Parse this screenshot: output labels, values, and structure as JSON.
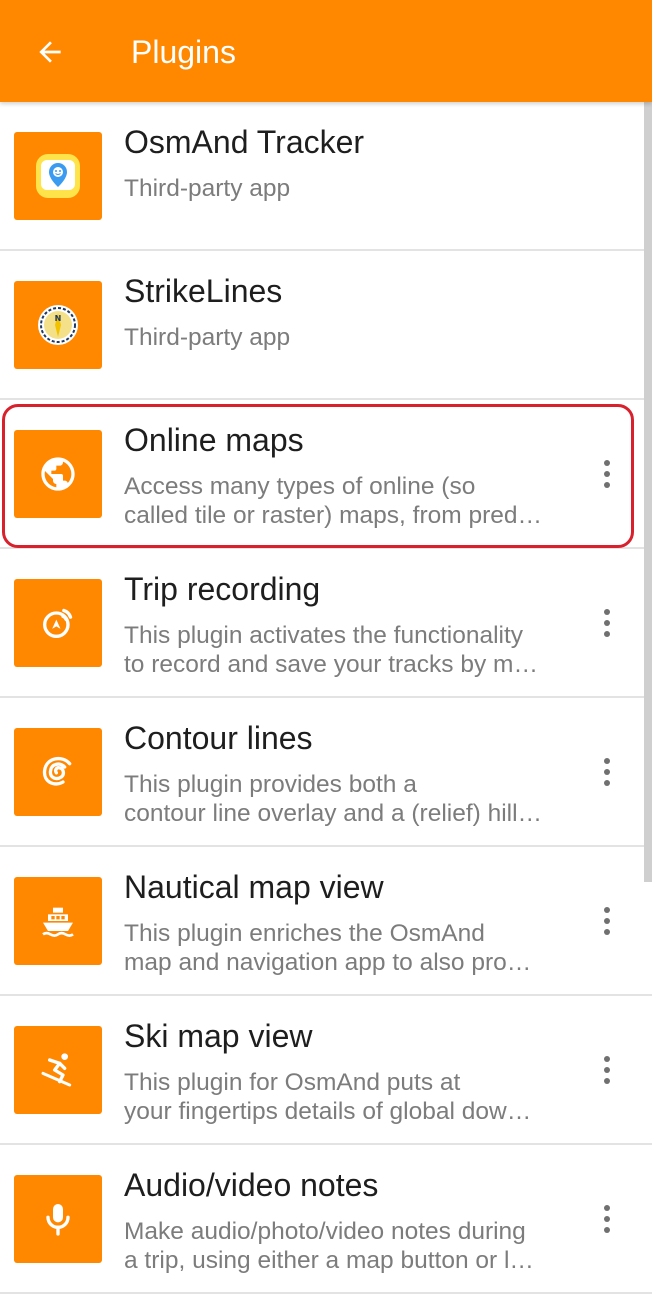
{
  "header": {
    "title": "Plugins",
    "back_icon": "arrow-back-icon",
    "background_color": "#ff8800"
  },
  "plugins": [
    {
      "title": "OsmAnd Tracker",
      "line1": "Third-party app",
      "line2": "",
      "icon": "tracker-app-icon",
      "has_menu": false
    },
    {
      "title": "StrikeLines",
      "line1": "Third-party app",
      "line2": "",
      "icon": "strikelines-app-icon",
      "has_menu": false
    },
    {
      "title": "Online maps",
      "line1": "Access many types of online (so",
      "line2": "called tile or raster) maps, from pred…",
      "icon": "globe-icon",
      "has_menu": true,
      "highlighted": true
    },
    {
      "title": "Trip recording",
      "line1": "This plugin activates the functionality",
      "line2": "to record and save your tracks by m…",
      "icon": "trip-recording-icon",
      "has_menu": true
    },
    {
      "title": "Contour lines",
      "line1": "This plugin provides both a",
      "line2": "contour line overlay and a (relief) hill…",
      "icon": "contour-lines-icon",
      "has_menu": true
    },
    {
      "title": "Nautical map view",
      "line1": "This plugin enriches the OsmAnd",
      "line2": "map and navigation app to also pro…",
      "icon": "ship-icon",
      "has_menu": true
    },
    {
      "title": "Ski map view",
      "line1": "This plugin for OsmAnd puts at",
      "line2": "your fingertips details of global dow…",
      "icon": "skier-icon",
      "has_menu": true
    },
    {
      "title": "Audio/video notes",
      "line1": "Make audio/photo/video notes during",
      "line2": "a trip, using either a map button or l…",
      "icon": "microphone-icon",
      "has_menu": true
    }
  ],
  "highlight_color": "#d8212d",
  "menu_icon": "more-vert-icon"
}
